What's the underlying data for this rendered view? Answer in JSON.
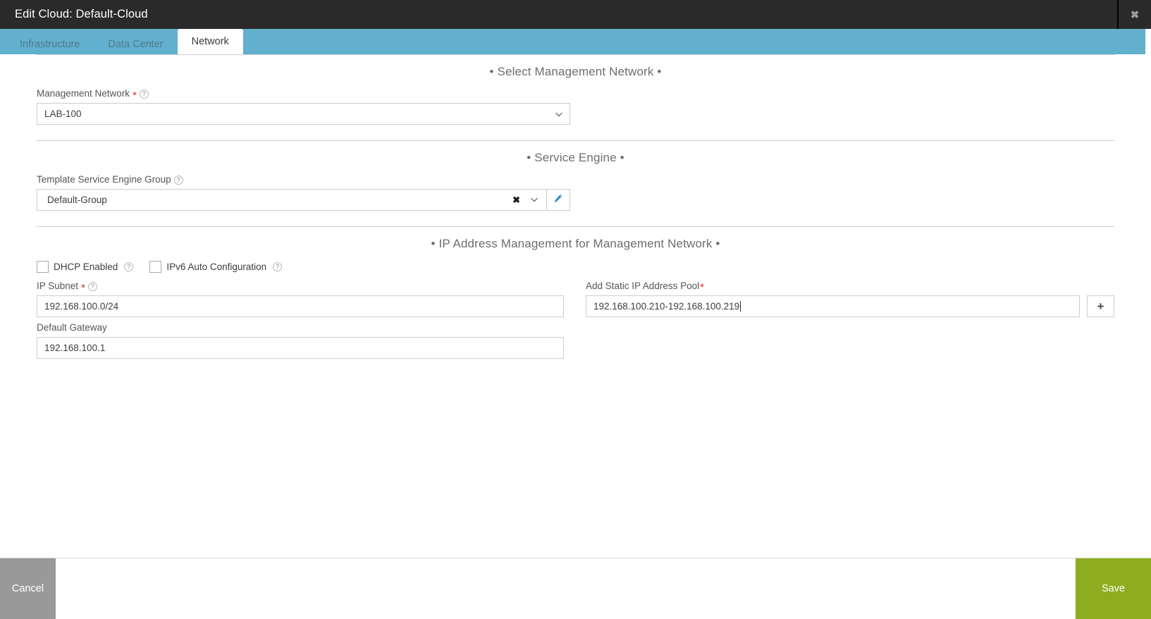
{
  "window": {
    "title": "Edit Cloud: Default-Cloud",
    "close_label": "✖"
  },
  "tabs": [
    {
      "label": "Infrastructure",
      "active": false
    },
    {
      "label": "Data Center",
      "active": false
    },
    {
      "label": "Network",
      "active": true
    }
  ],
  "sections": {
    "management_network": {
      "heading": "• Select Management Network •",
      "field_label": "Management Network",
      "required_marker": "*",
      "help": "?",
      "value": "LAB-100"
    },
    "service_engine": {
      "heading": "• Service Engine •",
      "field_label": "Template Service Engine Group",
      "help": "?",
      "value": "Default-Group",
      "clear_label": "✖",
      "edit_label": "edit"
    },
    "ipam": {
      "heading": "• IP Address Management for Management Network •",
      "dhcp_label": "DHCP Enabled",
      "dhcp_help": "?",
      "dhcp_checked": false,
      "ipv6_label": "IPv6 Auto Configuration",
      "ipv6_help": "?",
      "ipv6_checked": false,
      "ip_subnet_label": "IP Subnet",
      "ip_subnet_required": "*",
      "ip_subnet_help": "?",
      "ip_subnet_value": "192.168.100.0/24",
      "pool_label": "Add Static IP Address Pool",
      "pool_required": "*",
      "pool_value": "192.168.100.210-192.168.100.219",
      "add_label": "+",
      "gateway_label": "Default Gateway",
      "gateway_value": "192.168.100.1"
    }
  },
  "footer": {
    "cancel_label": "Cancel",
    "save_label": "Save"
  },
  "colors": {
    "titlebar": "#2a2a2a",
    "tabbar": "#62b0ce",
    "save": "#8ead1e",
    "cancel": "#999999",
    "required": "#e02b27",
    "accent_edit": "#3a8fc4"
  }
}
